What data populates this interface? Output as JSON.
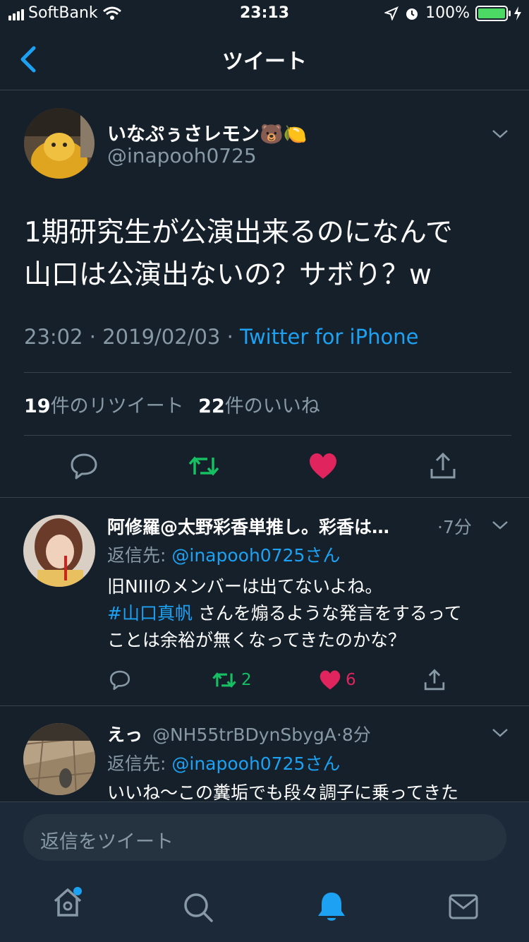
{
  "status_bar": {
    "carrier": "SoftBank",
    "time": "23:13",
    "battery": "100%"
  },
  "nav": {
    "title": "ツイート"
  },
  "tweet": {
    "display_name": "いなぷぅさレモン🐻🍋",
    "handle": "@inapooh0725",
    "text_line1": "1期研究生が公演出来るのになんで",
    "text_line2": "山口は公演出ないの？サボり？w",
    "time": "23:02",
    "date": "2019/02/03",
    "sep": " · ",
    "source": "Twitter for iPhone",
    "retweet_count": "19",
    "retweet_label": "件のリツイート",
    "like_count": "22",
    "like_label": "件のいいね"
  },
  "replies": [
    {
      "display_name": "阿修羅@太野彩香単推し。彩香は…",
      "handle": "",
      "time": "·7分",
      "reply_to_label": "返信先: ",
      "reply_to": "@inapooh0725さん",
      "body_line1": "旧NIIIのメンバーは出てないよね。",
      "hashtag": "#山口真帆",
      "body_line2_rest": " さんを煽るような発言をするって",
      "body_line3": "ことは余裕が無くなってきたのかな？",
      "retweets": "2",
      "likes": "6"
    },
    {
      "display_name": "えっ",
      "handle": "@NH55trBDynSbygA",
      "time": "·8分",
      "reply_to_label": "返信先: ",
      "reply_to": "@inapooh0725さん",
      "body_line1": "いいね〜この糞垢でも段々調子に乗ってきた"
    }
  ],
  "compose": {
    "placeholder": "返信をツイート"
  },
  "colors": {
    "background": "#15202b",
    "accent": "#1da1f2",
    "retweet": "#17bf63",
    "like": "#e0245e",
    "muted": "#8899a6"
  },
  "icons": [
    "back-chevron-icon",
    "reply-icon",
    "retweet-icon",
    "heart-icon",
    "share-icon",
    "home-icon",
    "search-icon",
    "notifications-icon",
    "messages-icon"
  ]
}
